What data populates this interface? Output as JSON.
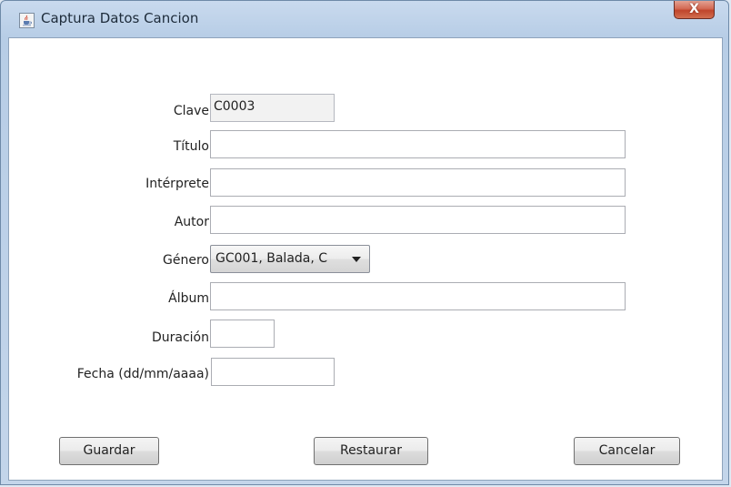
{
  "window": {
    "title": "Captura Datos Cancion",
    "close_label": "X"
  },
  "form": {
    "clave": {
      "label": "Clave",
      "value": "C0003"
    },
    "titulo": {
      "label": "Título",
      "value": ""
    },
    "interprete": {
      "label": "Intérprete",
      "value": ""
    },
    "autor": {
      "label": "Autor",
      "value": ""
    },
    "genero": {
      "label": "Género",
      "selected": "GC001, Balada, C"
    },
    "album": {
      "label": "Álbum",
      "value": ""
    },
    "duracion": {
      "label": "Duración",
      "value": ""
    },
    "fecha": {
      "label": "Fecha (dd/mm/aaaa)",
      "value": ""
    }
  },
  "buttons": {
    "guardar": "Guardar",
    "restaurar": "Restaurar",
    "cancelar": "Cancelar"
  },
  "colors": {
    "title_bar": "#b7cde6",
    "close_button": "#c0452c",
    "client_bg": "#ffffff"
  },
  "icons": {
    "app": "java-cup-icon",
    "close": "close-icon",
    "dropdown": "chevron-down-icon"
  }
}
